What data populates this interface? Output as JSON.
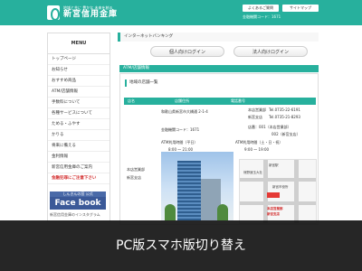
{
  "header": {
    "logo_tagline": "地域と共に 豊かな 未来を創る",
    "logo_name": "新宮信用金庫",
    "btn_faq": "よくあるご質問",
    "btn_sitemap": "サイトマップ",
    "info": "金融機関コード：1671",
    "brand_color": "#27b09d"
  },
  "sidebar": {
    "title": "MENU",
    "items": [
      "トップページ",
      "お知らせ",
      "おすすめ商品",
      "ATM/店舗情報",
      "手数料について",
      "各種サービスについて",
      "ためる・ふやす",
      "かりる",
      "将来に備える",
      "金利情報",
      "新宮信用金庫のご案内",
      "金融犯罪にご注意下さい"
    ],
    "facebook_top": "しんきんの窓 公式",
    "facebook_label": "Face book",
    "instagram": "新宮信用金庫のインスタグラム"
  },
  "main": {
    "internet_banking_title": "インターネットバンキング",
    "personal_login": "個人向けログイン",
    "corporate_login": "法人向けログイン",
    "atm_title": "ATM/店舗情報",
    "region_title": "地域の店舗一覧",
    "table_headers": [
      "店名",
      "店舗住所",
      "電話番号"
    ],
    "branch_name": "本店営業部",
    "branch_sub": "新宮支店",
    "address": "和歌山県新宮市大橋通 2-1-4",
    "code": "金融機関コード：1671",
    "atm_weekday_label": "ATM利用時間（平日）",
    "atm_weekday_time": "8:00 ～ 21:00",
    "tel1": "Tel.0735-22-6191",
    "tel2": "Tel.0735-21-8293",
    "dept1": "本店営業部",
    "dept2": "新宮支店",
    "store_no": "店番：001（本店営業部）",
    "store_no2": "002（新宮支店）",
    "atm_weekend_label": "ATM利用時間（土・日・祝）",
    "atm_weekend_time": "9:00 ～ 19:00"
  },
  "map": {
    "label_station": "新宮駅",
    "label_shrine": "熊野速玉大社",
    "label_city": "新宮市役所",
    "label_office": "本店営業部",
    "label_branch": "新宮支店"
  },
  "overlay": {
    "text": "PC版スマホ版切り替え"
  }
}
